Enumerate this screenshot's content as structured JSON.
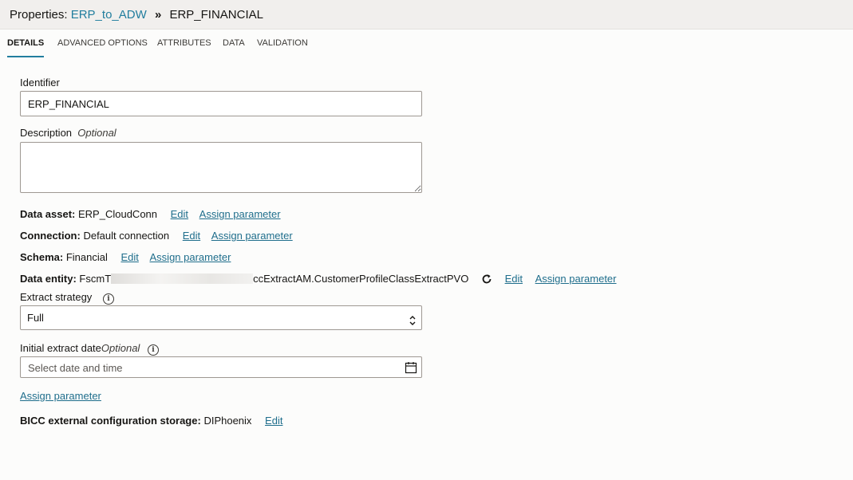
{
  "header": {
    "prefix": "Properties:",
    "link": "ERP_to_ADW",
    "separator": "»",
    "current": "ERP_FINANCIAL"
  },
  "tabs": [
    {
      "label": "DETAILS",
      "active": true
    },
    {
      "label": "ADVANCED OPTIONS"
    },
    {
      "label": "ATTRIBUTES"
    },
    {
      "label": "DATA"
    },
    {
      "label": "VALIDATION"
    }
  ],
  "identifier": {
    "label": "Identifier",
    "value": "ERP_FINANCIAL"
  },
  "description": {
    "label": "Description",
    "optional": "Optional",
    "value": ""
  },
  "data_asset": {
    "label": "Data asset:",
    "value": "ERP_CloudConn",
    "edit": "Edit",
    "assign": "Assign parameter"
  },
  "connection": {
    "label": "Connection:",
    "value": "Default connection",
    "edit": "Edit",
    "assign": "Assign parameter"
  },
  "schema": {
    "label": "Schema:",
    "value": "Financial",
    "edit": "Edit",
    "assign": "Assign parameter"
  },
  "data_entity": {
    "label": "Data entity:",
    "value_start": "FscmT",
    "value_end": "ccExtractAM.CustomerProfileClassExtractPVO",
    "refresh_icon": "refresh-icon",
    "edit": "Edit",
    "assign": "Assign parameter"
  },
  "extract_strategy": {
    "label": "Extract strategy",
    "value": "Full",
    "info_icon": "info-icon"
  },
  "initial_extract": {
    "label": "Initial extract date",
    "optional": "Optional",
    "placeholder": "Select date and time",
    "info_icon": "info-icon",
    "calendar_icon": "calendar-icon"
  },
  "assign_parameter": "Assign parameter",
  "bicc": {
    "label": "BICC external configuration storage:",
    "value": "DIPhoenix",
    "edit": "Edit"
  },
  "colors": {
    "link": "#1f6e8c",
    "accent": "#227e9e"
  }
}
